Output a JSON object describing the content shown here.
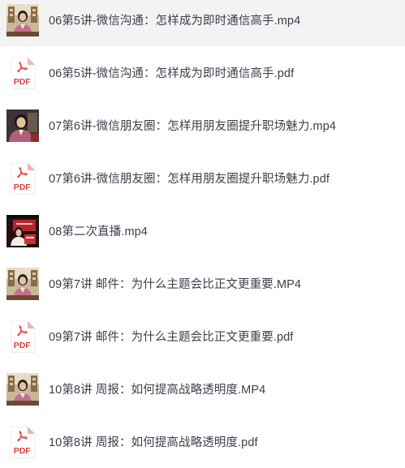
{
  "files": [
    {
      "name": "06第5讲-微信沟通：怎样成为即时通信高手.mp4",
      "type": "video",
      "thumb": "office-pink",
      "selected": true
    },
    {
      "name": "06第5讲-微信沟通：怎样成为即时通信高手.pdf",
      "type": "pdf",
      "icon_label": "PDF",
      "selected": false
    },
    {
      "name": "07第6讲-微信朋友圈：怎样用朋友圈提升职场魅力.mp4",
      "type": "video",
      "thumb": "portrait-dark",
      "selected": false
    },
    {
      "name": "07第6讲-微信朋友圈：怎样用朋友圈提升职场魅力.pdf",
      "type": "pdf",
      "icon_label": "PDF",
      "selected": false
    },
    {
      "name": "08第二次直播.mp4",
      "type": "video",
      "thumb": "live-red",
      "selected": false
    },
    {
      "name": "09第7讲 邮件：为什么主题会比正文更重要.MP4",
      "type": "video",
      "thumb": "office-pink",
      "selected": false
    },
    {
      "name": "09第7讲 邮件：为什么主题会比正文更重要.pdf",
      "type": "pdf",
      "icon_label": "PDF",
      "selected": false
    },
    {
      "name": "10第8讲 周报：如何提高战略透明度.MP4",
      "type": "video",
      "thumb": "office-pink",
      "selected": false
    },
    {
      "name": "10第8讲 周报：如何提高战略透明度.pdf",
      "type": "pdf",
      "icon_label": "PDF",
      "selected": false
    }
  ],
  "colors": {
    "pdf_red": "#e0413a",
    "text": "#3a3f4a",
    "selected_bg": "#f3f3f4"
  }
}
